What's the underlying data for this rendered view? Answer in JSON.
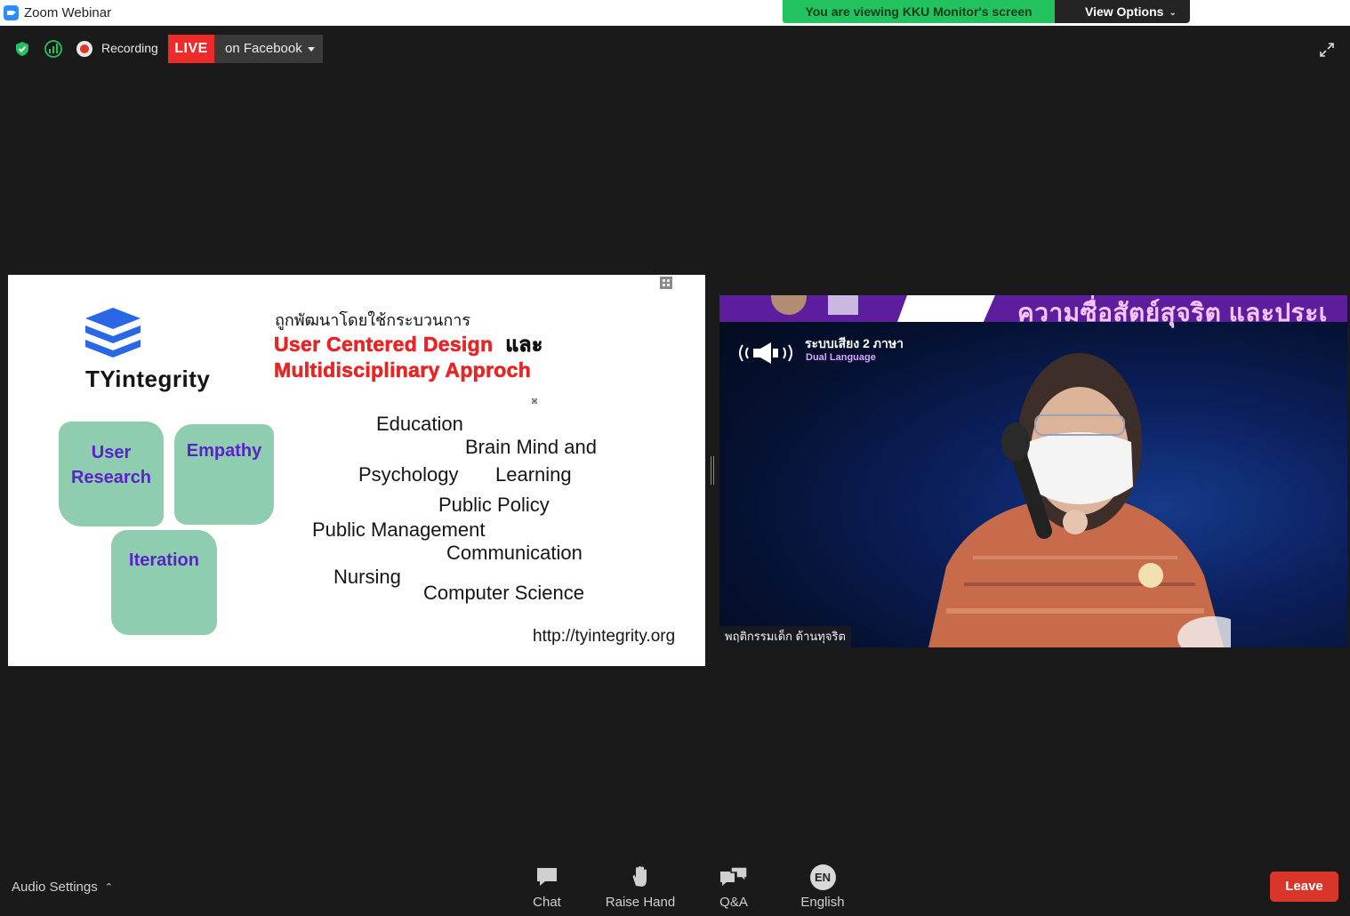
{
  "window": {
    "title": "Zoom Webinar",
    "icon": "zoom-camera-icon"
  },
  "share_banner": {
    "text": "You are viewing KKU Monitor's screen",
    "color": "#22c35e"
  },
  "view_options": {
    "label": "View Options"
  },
  "top_toolbar": {
    "recording_label": "Recording",
    "live_badge": "LIVE",
    "live_target": "on Facebook",
    "icons": [
      "security-shield-icon",
      "connection-signal-icon",
      "recording-dot-icon",
      "fullscreen-icon"
    ],
    "live_color": "#ee2b2b"
  },
  "slide": {
    "logo_text": "TYintegrity",
    "thai_subtitle": "ถูกพัฒนาโดยใช้กระบวนการ",
    "title_line1": "User Centered Design",
    "title_and": "และ",
    "title_line2": "Multidisciplinary Approch",
    "tiny_mark": "⌘",
    "blobs": [
      "User Research",
      "Empathy",
      "Iteration"
    ],
    "blob_lines": {
      "user_research": [
        "User",
        "Research"
      ]
    },
    "disciplines": [
      "Education",
      "Brain Mind and",
      "Psychology",
      "Learning",
      "Public Policy",
      "Public Management",
      "Communication",
      "Nursing",
      "Computer Science"
    ],
    "url": "http://tyintegrity.org",
    "title_color": "#e62525",
    "blob_color": "#8ecdb0",
    "blob_text_color": "#5a23c8"
  },
  "video": {
    "headline": "ความซื่อสัตย์สุจริต และประเ",
    "dual_language_thai": "ระบบเสียง 2 ภาษา",
    "dual_language_en": "Dual Language",
    "participant_name": "พฤติกรรมเด็ก ด้านทุจริต"
  },
  "bottom_bar": {
    "audio_settings": "Audio Settings",
    "chat": "Chat",
    "raise_hand": "Raise Hand",
    "qa": "Q&A",
    "language_badge": "EN",
    "language": "English",
    "leave": "Leave",
    "leave_color": "#d9352b"
  }
}
